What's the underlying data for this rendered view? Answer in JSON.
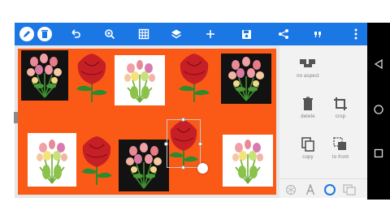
{
  "toolbar": {
    "icons": [
      "pencil-icon",
      "trash-icon",
      "undo-icon",
      "zoom-icon",
      "grid-icon",
      "layers-icon",
      "add-icon",
      "save-icon",
      "share-icon",
      "quote-icon",
      "more-icon"
    ]
  },
  "panel": {
    "items": [
      {
        "label": "no aspect",
        "icon": "aspect-icon"
      },
      {
        "label": "delete",
        "icon": "trash-icon"
      },
      {
        "label": "crop",
        "icon": "crop-icon"
      },
      {
        "label": "copy",
        "icon": "copy-icon"
      },
      {
        "label": "to front",
        "icon": "bring-to-front-icon"
      }
    ],
    "bottom_tabs": [
      "effects-icon",
      "text-icon",
      "shape-icon",
      "layers-icon"
    ]
  },
  "colors": {
    "toolbar": "#1a77e3",
    "canvas": "#fb5a16",
    "panel": "#f2f2f2",
    "rose": "#c62026",
    "leaf": "#2d8a2d"
  }
}
